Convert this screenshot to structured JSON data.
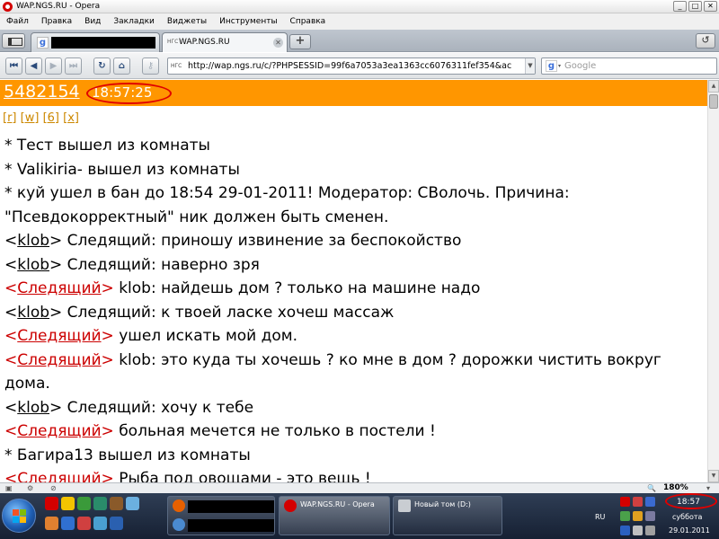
{
  "window": {
    "title": "WAP.NGS.RU - Opera",
    "min": "_",
    "max": "□",
    "close": "✕"
  },
  "menu": [
    "Файл",
    "Правка",
    "Вид",
    "Закладки",
    "Виджеты",
    "Инструменты",
    "Справка"
  ],
  "tabs": [
    {
      "label": ""
    },
    {
      "label": "WAP.NGS.RU",
      "site_tag": "НГС"
    }
  ],
  "new_tab_symbol": "+",
  "toolbar": {
    "url_tag": "НГС",
    "url": "http://wap.ngs.ru/c/?PHPSESSID=99f6a7053a3ea1363cc6076311fef354&ac",
    "search_placeholder": "Google",
    "buttons": [
      "⏮",
      "◀",
      "▶",
      "⏭",
      "↻",
      "⌂",
      "⚷"
    ]
  },
  "page": {
    "counter": "5482154",
    "time": "18:57:25",
    "links": [
      "[r]",
      "[w]",
      "[6]",
      "[x]"
    ],
    "messages": [
      {
        "type": "system",
        "text": "* Тест вышел из комнаты"
      },
      {
        "type": "system",
        "text": "* Valikiria- вышел из комнаты"
      },
      {
        "type": "system",
        "text": "* куй ушел в бан до 18:54 29-01-2011! Модератор: СВолочь. Причина: \"Псевдокорректный\" ник должен быть сменен."
      },
      {
        "type": "chat",
        "nick": "klob",
        "nick_color": "#000000",
        "text": " Следящий: приношу извинение за беспокойство"
      },
      {
        "type": "chat",
        "nick": "klob",
        "nick_color": "#000000",
        "text": " Следящий: наверно зря"
      },
      {
        "type": "chat",
        "nick": "Следящий",
        "nick_color": "#cc0000",
        "text": " klob: найдешь дом ? только на машине надо"
      },
      {
        "type": "chat",
        "nick": "klob",
        "nick_color": "#000000",
        "text": " Следящий: к твоей ласке хочеш массаж"
      },
      {
        "type": "chat",
        "nick": "Следящий",
        "nick_color": "#cc0000",
        "text": " ушел искать мой дом."
      },
      {
        "type": "chat",
        "nick": "Следящий",
        "nick_color": "#cc0000",
        "text": " klob: это куда ты хочешь ? ко мне в дом ? дорожки чистить вокруг дома."
      },
      {
        "type": "chat",
        "nick": "klob",
        "nick_color": "#000000",
        "text": " Следящий: хочу к тебе"
      },
      {
        "type": "chat",
        "nick": "Следящий",
        "nick_color": "#cc0000",
        "text": " больная мечется не только в постели !"
      },
      {
        "type": "system",
        "text": "* Багира13 вышел из комнаты"
      },
      {
        "type": "chat",
        "nick": "Следящий",
        "nick_color": "#cc0000",
        "text": " Рыба под овощами - это вещь !"
      }
    ]
  },
  "status": {
    "zoom": "180%"
  },
  "taskbar": {
    "tasks": [
      {
        "label": ""
      },
      {
        "label": "WAP.NGS.RU - Opera"
      },
      {
        "label": "Новый том (D:)"
      }
    ],
    "lang": "RU",
    "clock_time": "18:57",
    "clock_day": "суббота",
    "clock_date": "29.01.2011"
  },
  "colors": {
    "header_orange": "#ff9600",
    "nick_red": "#cc0000",
    "link_gold": "#cc8800",
    "annotation_red": "#e00000"
  }
}
